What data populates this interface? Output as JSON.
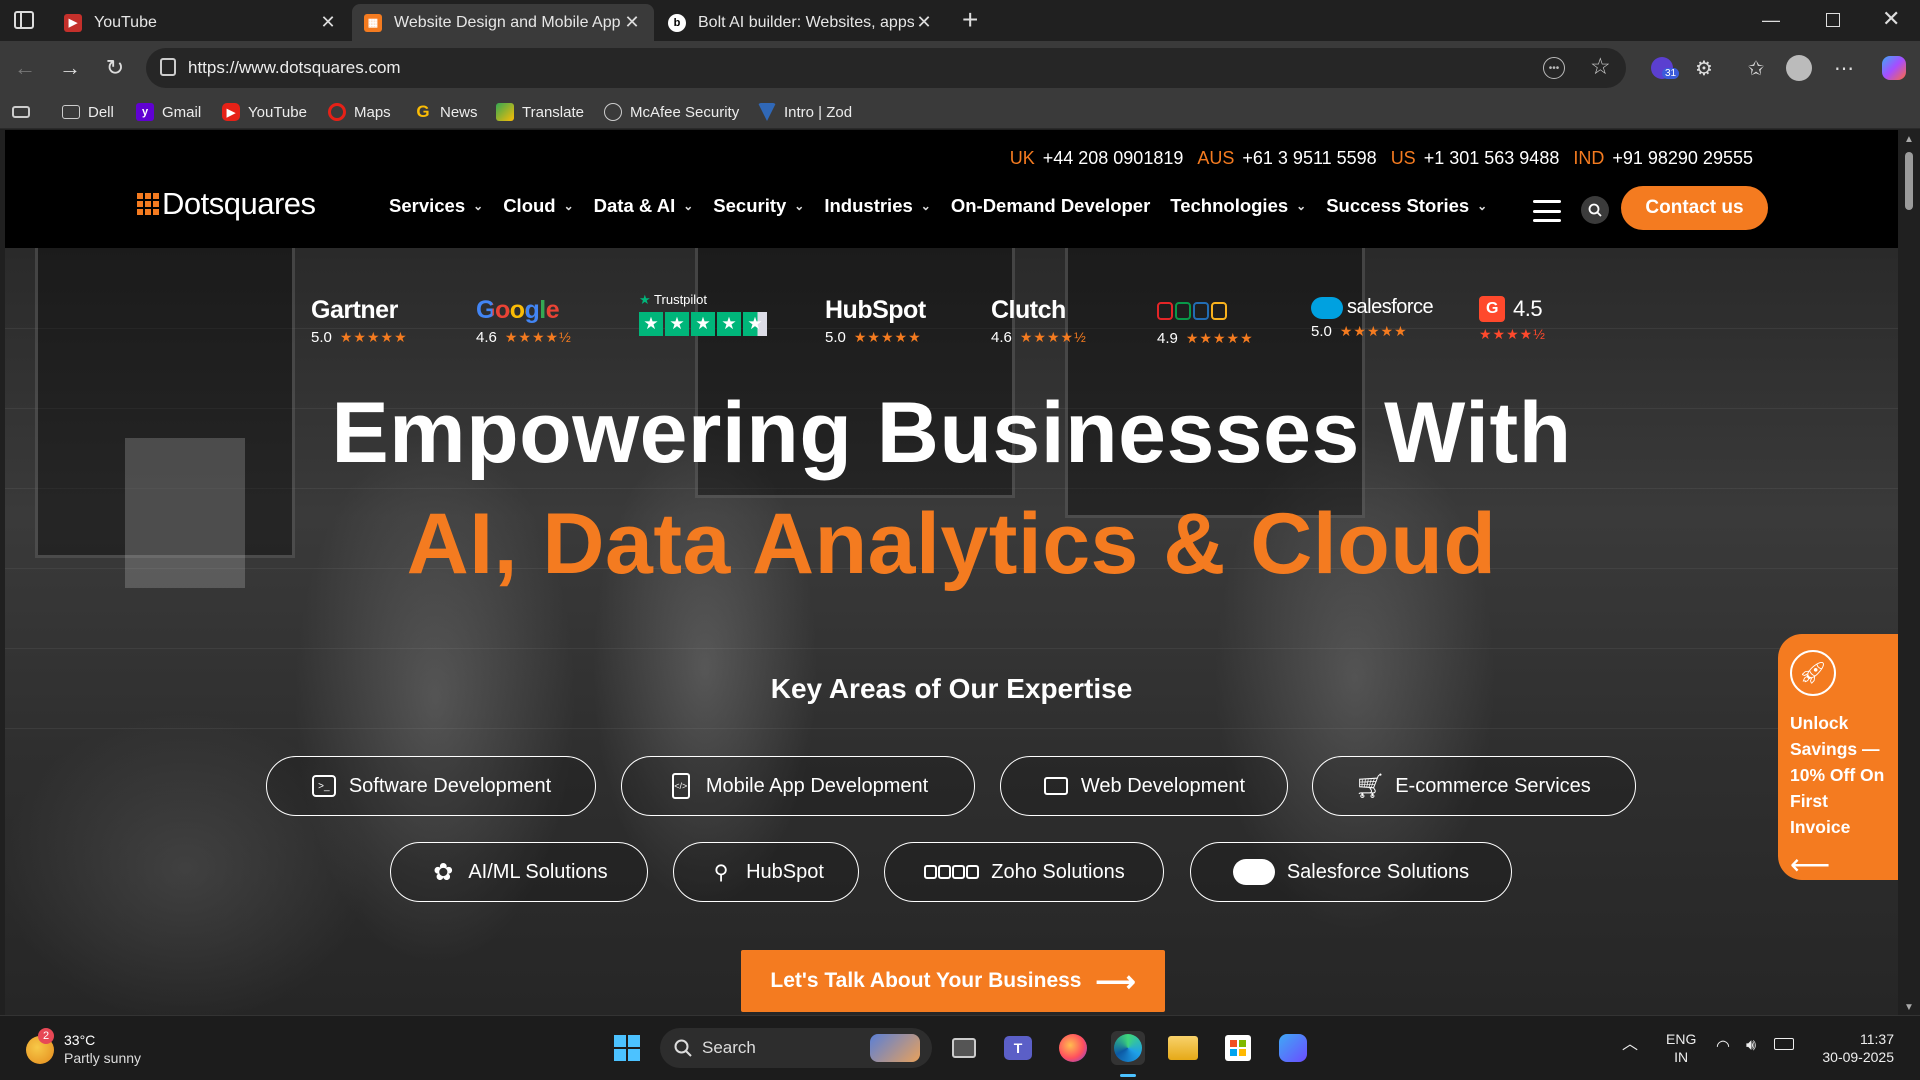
{
  "browser": {
    "tabs": [
      {
        "title": "YouTube",
        "active": false
      },
      {
        "title": "Website Design and Mobile App Development",
        "active": true
      },
      {
        "title": "Bolt AI builder: Websites, apps & prototypes",
        "active": false
      }
    ],
    "url": "https://www.dotsquares.com",
    "extension_badge": "31",
    "bookmarks": [
      "Dell",
      "Gmail",
      "YouTube",
      "Maps",
      "News",
      "Translate",
      "McAfee Security",
      "Intro | Zod"
    ]
  },
  "site": {
    "phones": [
      {
        "country": "UK",
        "number": "+44 208 0901819"
      },
      {
        "country": "AUS",
        "number": "+61 3 9511 5598"
      },
      {
        "country": "US",
        "number": "+1 301 563 9488"
      },
      {
        "country": "IND",
        "number": "+91 98290 29555"
      }
    ],
    "logo": "Dotsquares",
    "nav": [
      "Services",
      "Cloud",
      "Data & AI",
      "Security",
      "Industries",
      "On-Demand Developer",
      "Technologies",
      "Success Stories"
    ],
    "nav_has_chevron": [
      true,
      true,
      true,
      true,
      true,
      false,
      true,
      true
    ],
    "contact": "Contact us",
    "ratings": [
      {
        "brand": "Gartner",
        "score": "5.0"
      },
      {
        "brand": "Google",
        "score": "4.6"
      },
      {
        "brand": "Trustpilot",
        "score": ""
      },
      {
        "brand": "HubSpot",
        "score": "5.0"
      },
      {
        "brand": "Clutch",
        "score": "4.6"
      },
      {
        "brand": "ZOHO",
        "score": "4.9"
      },
      {
        "brand": "salesforce",
        "score": "5.0"
      },
      {
        "brand": "G2",
        "score": "4.5"
      }
    ],
    "headline_line1": "Empowering Businesses With",
    "headline_line2": "AI, Data Analytics & Cloud",
    "expertise_title": "Key Areas of Our Expertise",
    "expertise_row1": [
      "Software Development",
      "Mobile App Development",
      "Web Development",
      "E-commerce Services"
    ],
    "expertise_row2": [
      "AI/ML Solutions",
      "HubSpot",
      "Zoho Solutions",
      "Salesforce Solutions"
    ],
    "cta": "Let's Talk About Your Business",
    "promo": "Unlock Savings — 10% Off On First Invoice",
    "accent_color": "#f47b20"
  },
  "taskbar": {
    "weather_temp": "33°C",
    "weather_desc": "Partly sunny",
    "weather_badge": "2",
    "search_placeholder": "Search",
    "lang_top": "ENG",
    "lang_bottom": "IN",
    "time": "11:37",
    "date": "30-09-2025"
  }
}
